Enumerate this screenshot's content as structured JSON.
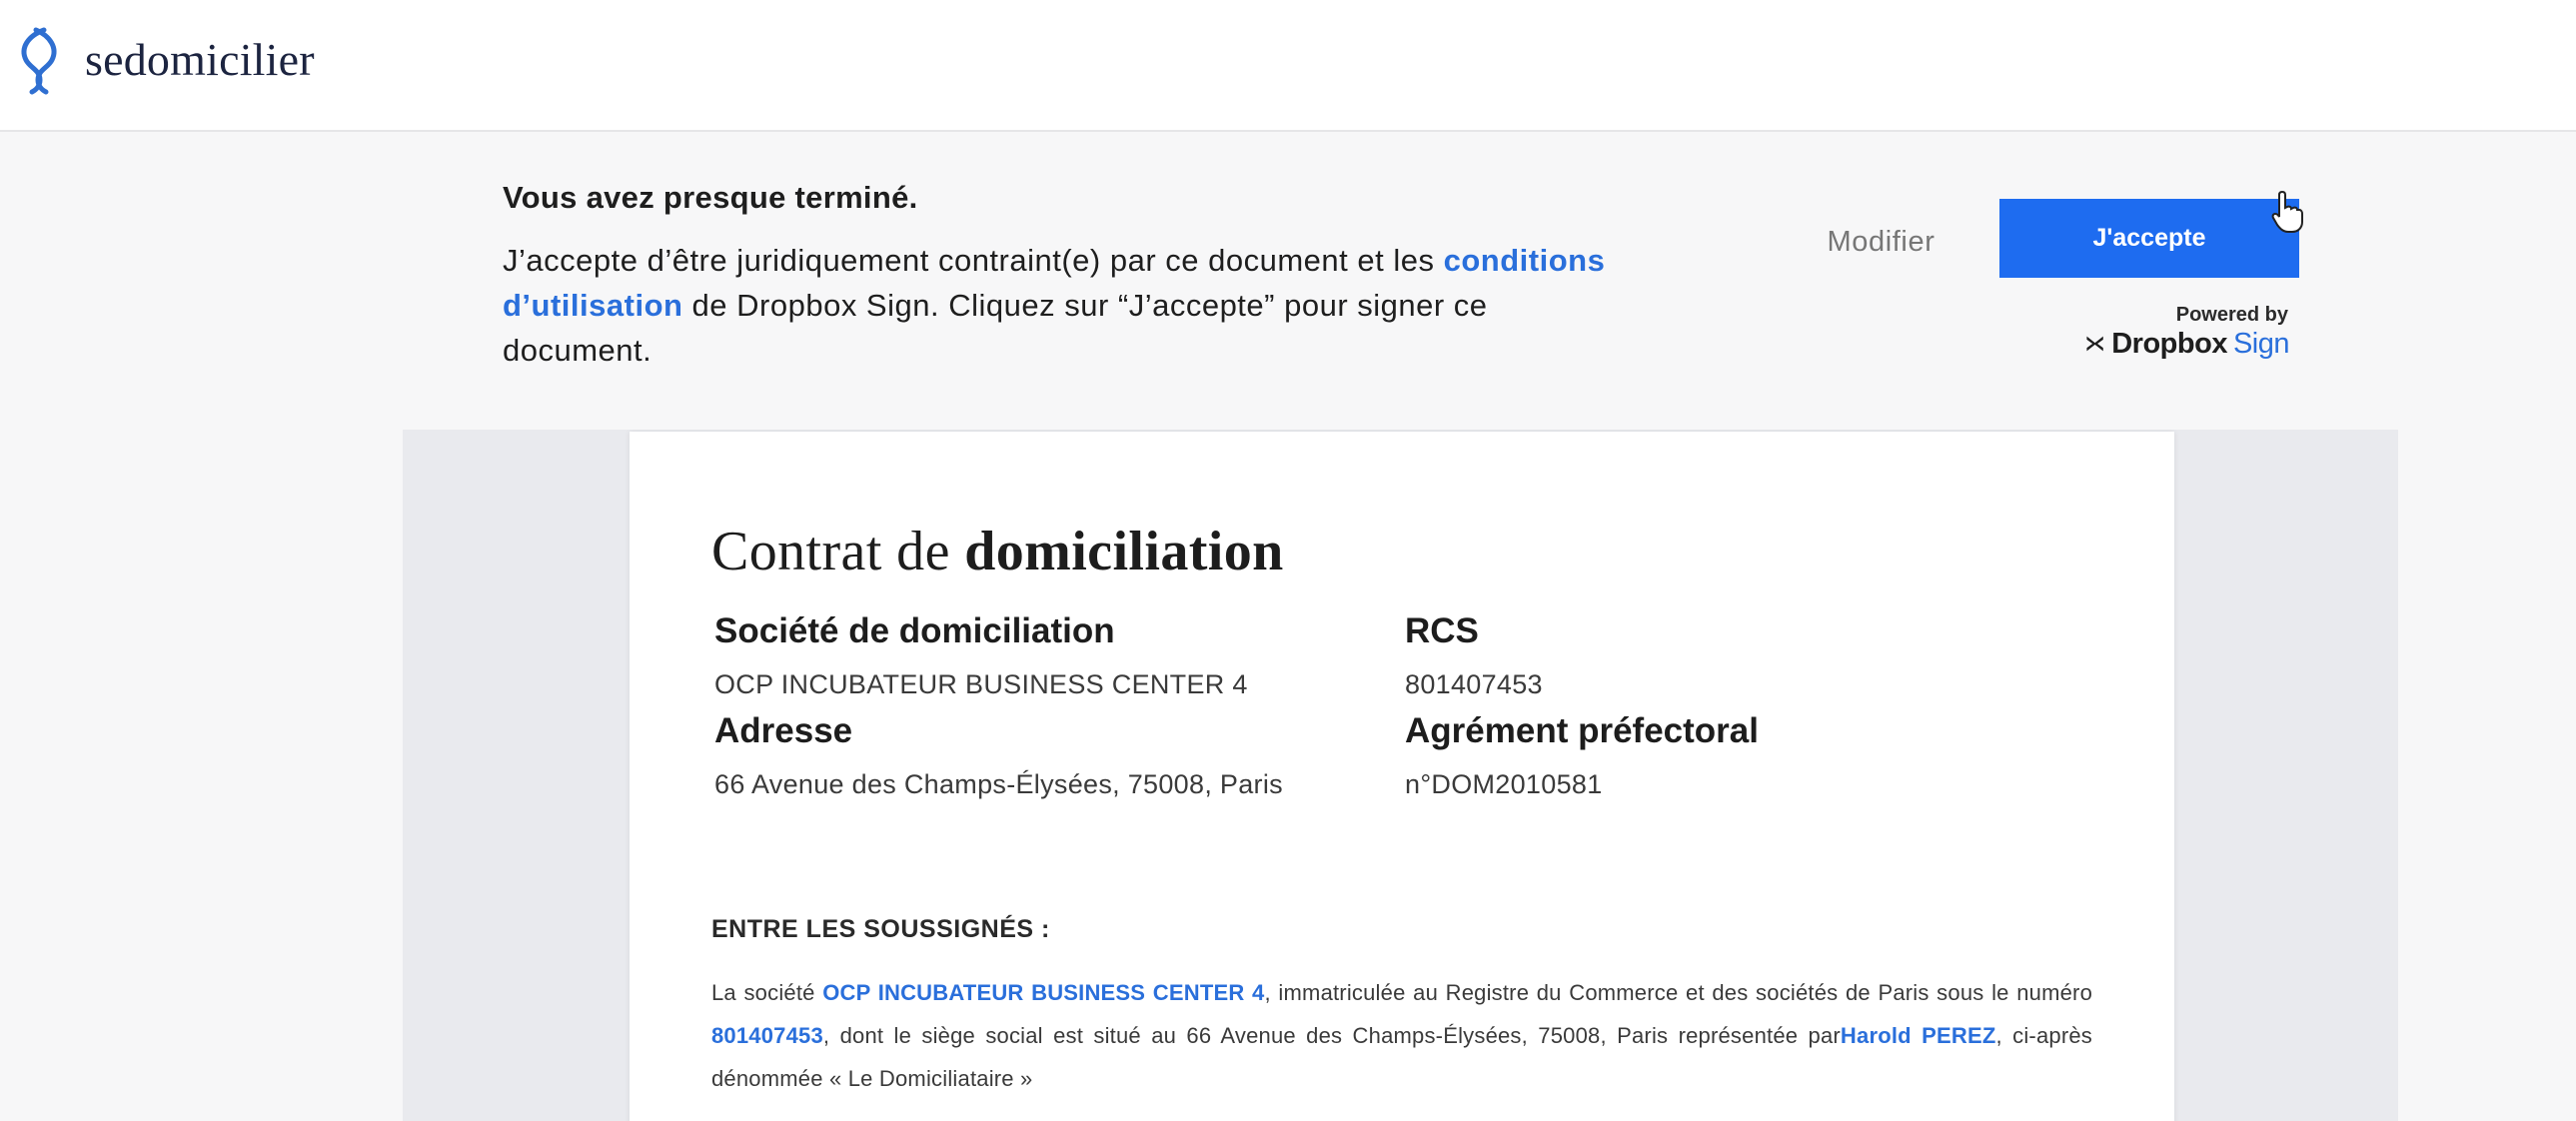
{
  "brand": {
    "name": "sedomicilier",
    "logo_icon": "sedomicilier-logo-icon"
  },
  "sign_bar": {
    "heading": "Vous avez presque terminé.",
    "text_before_link": "J’accepte d’être juridiquement contraint(e) par ce document et les ",
    "link_text": "conditions d’utilisation",
    "text_after_link": " de Dropbox Sign. Cliquez sur “J’accepte” pour signer ce document.",
    "modify_label": "Modifier",
    "accept_label": "J'accepte",
    "powered_by": "Powered by",
    "provider_word": "Dropbox",
    "provider_suffix": "Sign",
    "accent_color": "#1e6cf0"
  },
  "document": {
    "title_regular": "Contrat de ",
    "title_bold": "domiciliation",
    "fields": {
      "company_label": "Société de domiciliation",
      "company_value": "OCP INCUBATEUR BUSINESS CENTER 4",
      "rcs_label": "RCS",
      "rcs_value": "801407453",
      "address_label": "Adresse",
      "address_value": "66 Avenue des Champs-Élysées, 75008, Paris",
      "approval_label": "Agrément préfectoral",
      "approval_value": "n°DOM2010581"
    },
    "section_heading": "ENTRE LES SOUSSIGNÉS :",
    "paragraph": {
      "part1": "La société ",
      "company": "OCP INCUBATEUR BUSINESS CENTER 4",
      "part2": ", immatriculée au Registre du Commerce et des sociétés de Paris sous le numéro ",
      "rcs": "801407453",
      "part3": ", dont le siège social est situé au 66 Avenue des Champs-Élysées, 75008, Paris représentée par",
      "representative": "Harold PEREZ",
      "part4": ", ci-après dénommée « Le Domiciliataire »"
    }
  }
}
